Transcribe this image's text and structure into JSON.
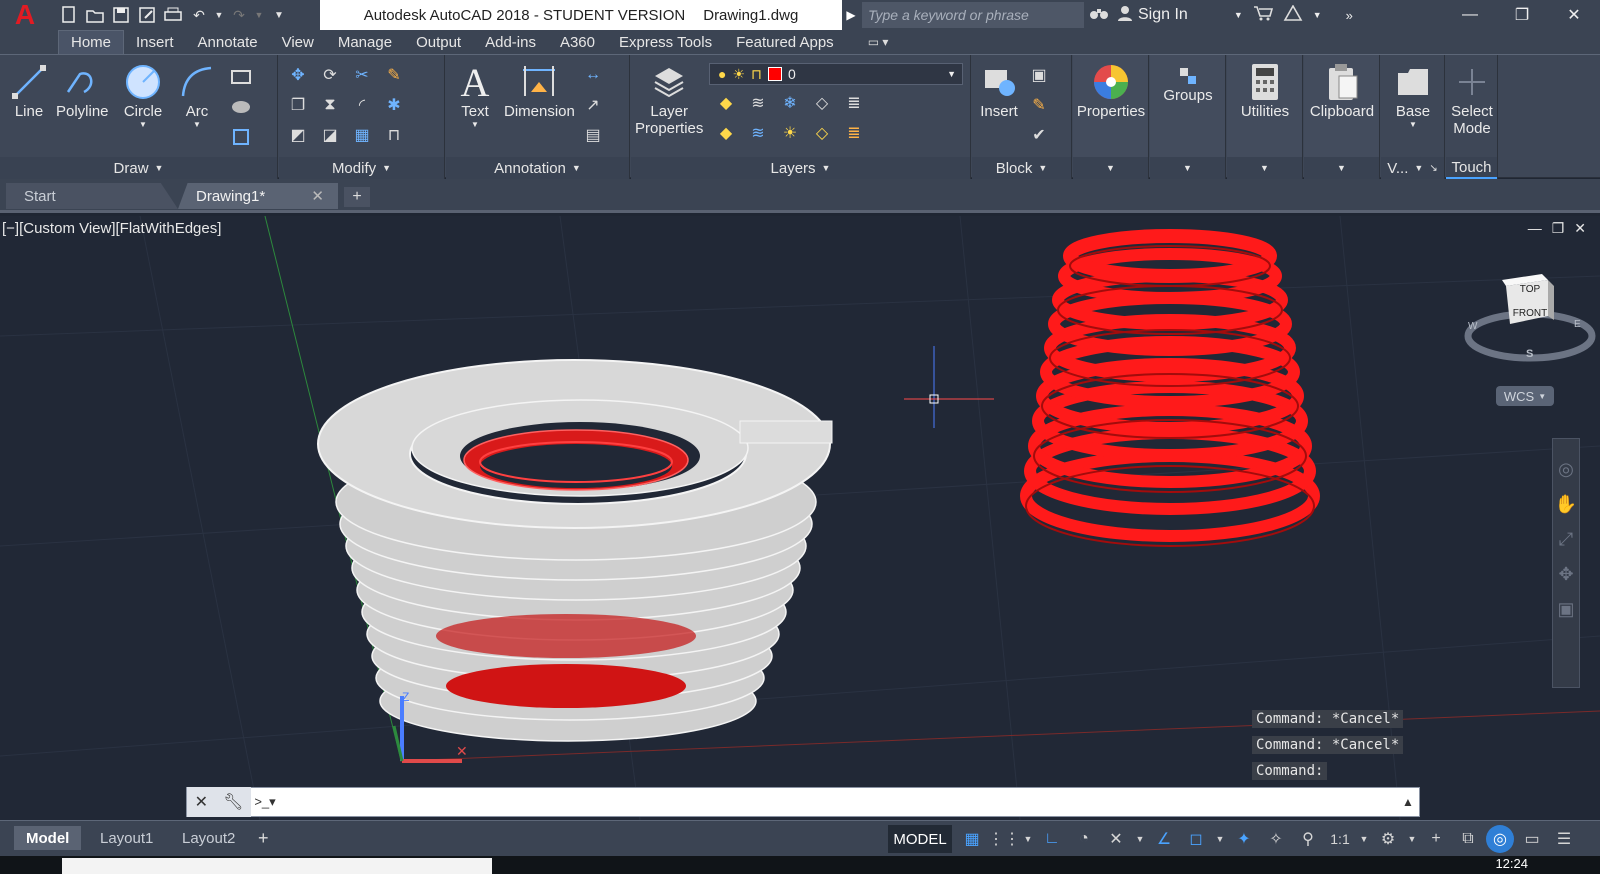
{
  "titlebar": {
    "app_letter": "A",
    "title": "Autodesk AutoCAD 2018 - STUDENT VERSION",
    "filename": "Drawing1.dwg",
    "search_placeholder": "Type a keyword or phrase",
    "sign_in": "Sign In"
  },
  "ribbon_tabs": [
    "Home",
    "Insert",
    "Annotate",
    "View",
    "Manage",
    "Output",
    "Add-ins",
    "A360",
    "Express Tools",
    "Featured Apps"
  ],
  "ribbon": {
    "draw": {
      "footer": "Draw",
      "tools": [
        "Line",
        "Polyline",
        "Circle",
        "Arc"
      ]
    },
    "modify": {
      "footer": "Modify"
    },
    "annotation": {
      "footer": "Annotation",
      "tools": [
        "Text",
        "Dimension"
      ]
    },
    "layers": {
      "footer": "Layers",
      "layer_props_line1": "Layer",
      "layer_props_line2": "Properties",
      "current_layer": "0"
    },
    "block": {
      "footer": "Block",
      "insert": "Insert"
    },
    "properties": {
      "label": "Properties"
    },
    "groups": {
      "label": "Groups"
    },
    "utilities": {
      "label": "Utilities"
    },
    "clipboard": {
      "label": "Clipboard"
    },
    "view": {
      "label": "Base",
      "footer": "V..."
    },
    "touch": {
      "line1": "Select",
      "line2": "Mode",
      "footer": "Touch"
    }
  },
  "doc_tabs": {
    "start": "Start",
    "drawing": "Drawing1*"
  },
  "viewport": {
    "label": "[−][Custom View][FlatWithEdges]",
    "viewcube_face": "FRONT",
    "viewcube_top": "TOP",
    "compass_w": "W",
    "compass_e": "E",
    "compass_s": "S",
    "wcs": "WCS"
  },
  "command_history": [
    "Command: *Cancel*",
    "Command: *Cancel*",
    "Command:"
  ],
  "command_line": {
    "value": ""
  },
  "layout_tabs": [
    "Model",
    "Layout1",
    "Layout2"
  ],
  "status": {
    "model": "MODEL",
    "scale": "1:1"
  },
  "clock": "12:24",
  "colors": {
    "accent_red": "#e21b23",
    "object_red": "#ff1a1a",
    "viewport_bg": "#212836",
    "ribbon_bg": "#3e4757"
  }
}
